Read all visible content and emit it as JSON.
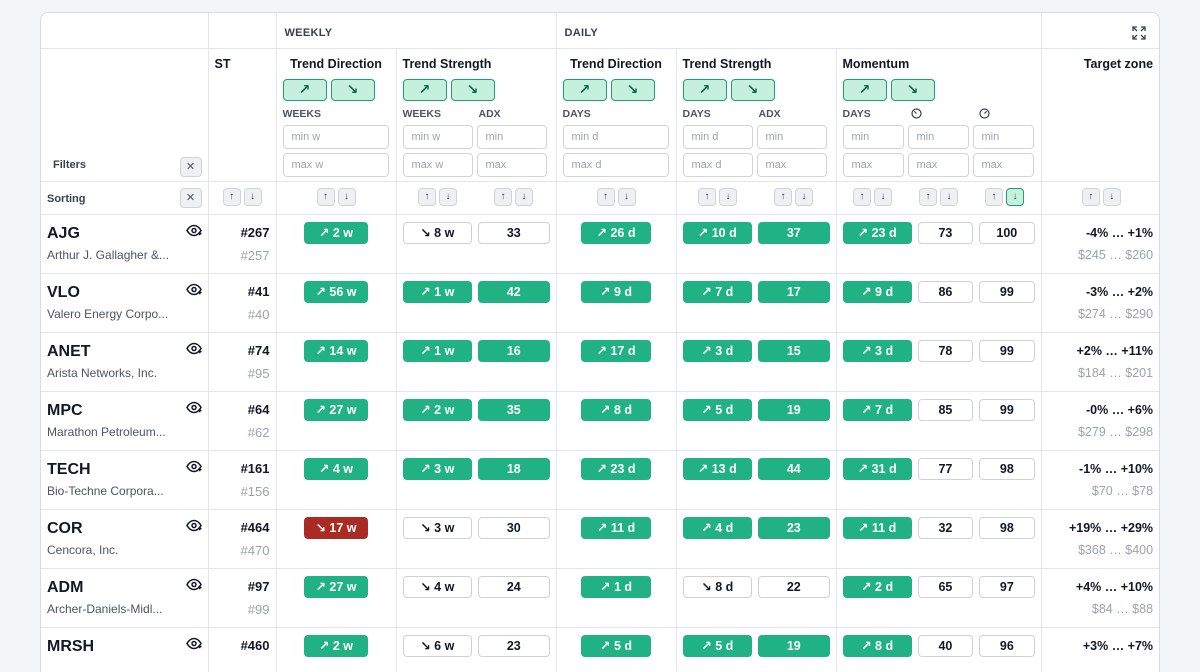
{
  "groups": {
    "weekly": "WEEKLY",
    "daily": "DAILY"
  },
  "headers": {
    "st": "ST",
    "trend_direction": "Trend Direction",
    "trend_strength": "Trend Strength",
    "momentum": "Momentum",
    "target_zone": "Target zone"
  },
  "filters": {
    "label": "Filters",
    "weeks": "WEEKS",
    "days": "DAYS",
    "adx": "ADX",
    "w_min": "min w",
    "w_max": "max w",
    "d_min": "min d",
    "d_max": "max d",
    "min": "min",
    "max": "max"
  },
  "sorting": {
    "label": "Sorting"
  },
  "arrows": {
    "up": "↗",
    "down": "↘"
  },
  "rows": [
    {
      "ticker": "AJG",
      "company": "Arthur J. Gallagher &...",
      "rank": "#267",
      "prev_rank": "#257",
      "w_dir": "↗ 2 w",
      "w_str": "↘ 8 w",
      "w_adx": "33",
      "d_dir": "↗ 26 d",
      "d_str": "↗ 10 d",
      "d_adx": "37",
      "m_days": "↗ 23 d",
      "m_a": "73",
      "m_b": "100",
      "tz_range": "-4% … +1%",
      "tz_price": "$245 … $260"
    },
    {
      "ticker": "VLO",
      "company": "Valero Energy Corpo...",
      "rank": "#41",
      "prev_rank": "#40",
      "w_dir": "↗ 56 w",
      "w_str": "↗ 1 w",
      "w_adx": "42",
      "d_dir": "↗ 9 d",
      "d_str": "↗ 7 d",
      "d_adx": "17",
      "m_days": "↗ 9 d",
      "m_a": "86",
      "m_b": "99",
      "tz_range": "-3% … +2%",
      "tz_price": "$274 … $290"
    },
    {
      "ticker": "ANET",
      "company": "Arista Networks, Inc.",
      "rank": "#74",
      "prev_rank": "#95",
      "w_dir": "↗ 14 w",
      "w_str": "↗ 1 w",
      "w_adx": "16",
      "d_dir": "↗ 17 d",
      "d_str": "↗ 3 d",
      "d_adx": "15",
      "m_days": "↗ 3 d",
      "m_a": "78",
      "m_b": "99",
      "tz_range": "+2% … +11%",
      "tz_price": "$184 … $201"
    },
    {
      "ticker": "MPC",
      "company": "Marathon Petroleum...",
      "rank": "#64",
      "prev_rank": "#62",
      "w_dir": "↗ 27 w",
      "w_str": "↗ 2 w",
      "w_adx": "35",
      "d_dir": "↗ 8 d",
      "d_str": "↗ 5 d",
      "d_adx": "19",
      "m_days": "↗ 7 d",
      "m_a": "85",
      "m_b": "99",
      "tz_range": "-0% … +6%",
      "tz_price": "$279 … $298"
    },
    {
      "ticker": "TECH",
      "company": "Bio-Techne Corpora...",
      "rank": "#161",
      "prev_rank": "#156",
      "w_dir": "↗ 4 w",
      "w_str": "↗ 3 w",
      "w_adx": "18",
      "d_dir": "↗ 23 d",
      "d_str": "↗ 13 d",
      "d_adx": "44",
      "m_days": "↗ 31 d",
      "m_a": "77",
      "m_b": "98",
      "tz_range": "-1% … +10%",
      "tz_price": "$70 … $78"
    },
    {
      "ticker": "COR",
      "company": "Cencora, Inc.",
      "rank": "#464",
      "prev_rank": "#470",
      "w_dir": "↘ 17 w",
      "w_str": "↘ 3 w",
      "w_adx": "30",
      "d_dir": "↗ 11 d",
      "d_str": "↗ 4 d",
      "d_adx": "23",
      "m_days": "↗ 11 d",
      "m_a": "32",
      "m_b": "98",
      "tz_range": "+19% … +29%",
      "tz_price": "$368 … $400"
    },
    {
      "ticker": "ADM",
      "company": "Archer-Daniels-Midl...",
      "rank": "#97",
      "prev_rank": "#99",
      "w_dir": "↗ 27 w",
      "w_str": "↘ 4 w",
      "w_adx": "24",
      "d_dir": "↗ 1 d",
      "d_str": "↘ 8 d",
      "d_adx": "22",
      "m_days": "↗ 2 d",
      "m_a": "65",
      "m_b": "97",
      "tz_range": "+4% … +10%",
      "tz_price": "$84 … $88"
    },
    {
      "ticker": "MRSH",
      "company": "",
      "rank": "#460",
      "prev_rank": "",
      "w_dir": "↗ 2 w",
      "w_str": "↘ 6 w",
      "w_adx": "23",
      "d_dir": "↗ 5 d",
      "d_str": "↗ 5 d",
      "d_adx": "19",
      "m_days": "↗ 8 d",
      "m_a": "40",
      "m_b": "96",
      "tz_range": "+3% … +7%",
      "tz_price": ""
    }
  ],
  "styles": [
    {
      "w_dir": "green",
      "w_str": "white",
      "w_adx": "white",
      "d_dir": "green",
      "d_str": "green",
      "d_adx": "green",
      "m_days": "green"
    },
    {
      "w_dir": "green",
      "w_str": "green",
      "w_adx": "green",
      "d_dir": "green",
      "d_str": "green",
      "d_adx": "green",
      "m_days": "green"
    },
    {
      "w_dir": "green",
      "w_str": "green",
      "w_adx": "green",
      "d_dir": "green",
      "d_str": "green",
      "d_adx": "green",
      "m_days": "green"
    },
    {
      "w_dir": "green",
      "w_str": "green",
      "w_adx": "green",
      "d_dir": "green",
      "d_str": "green",
      "d_adx": "green",
      "m_days": "green"
    },
    {
      "w_dir": "green",
      "w_str": "green",
      "w_adx": "green",
      "d_dir": "green",
      "d_str": "green",
      "d_adx": "green",
      "m_days": "green"
    },
    {
      "w_dir": "red",
      "w_str": "white",
      "w_adx": "white",
      "d_dir": "green",
      "d_str": "green",
      "d_adx": "green",
      "m_days": "green"
    },
    {
      "w_dir": "green",
      "w_str": "white",
      "w_adx": "white",
      "d_dir": "green",
      "d_str": "white",
      "d_adx": "white",
      "m_days": "green"
    },
    {
      "w_dir": "green",
      "w_str": "white",
      "w_adx": "white",
      "d_dir": "green",
      "d_str": "green",
      "d_adx": "green",
      "m_days": "green"
    }
  ],
  "colors": {
    "accent": "#20b283",
    "accent_light": "#c4f0dd",
    "negative": "#aa2a24",
    "muted": "#9aa3af"
  }
}
